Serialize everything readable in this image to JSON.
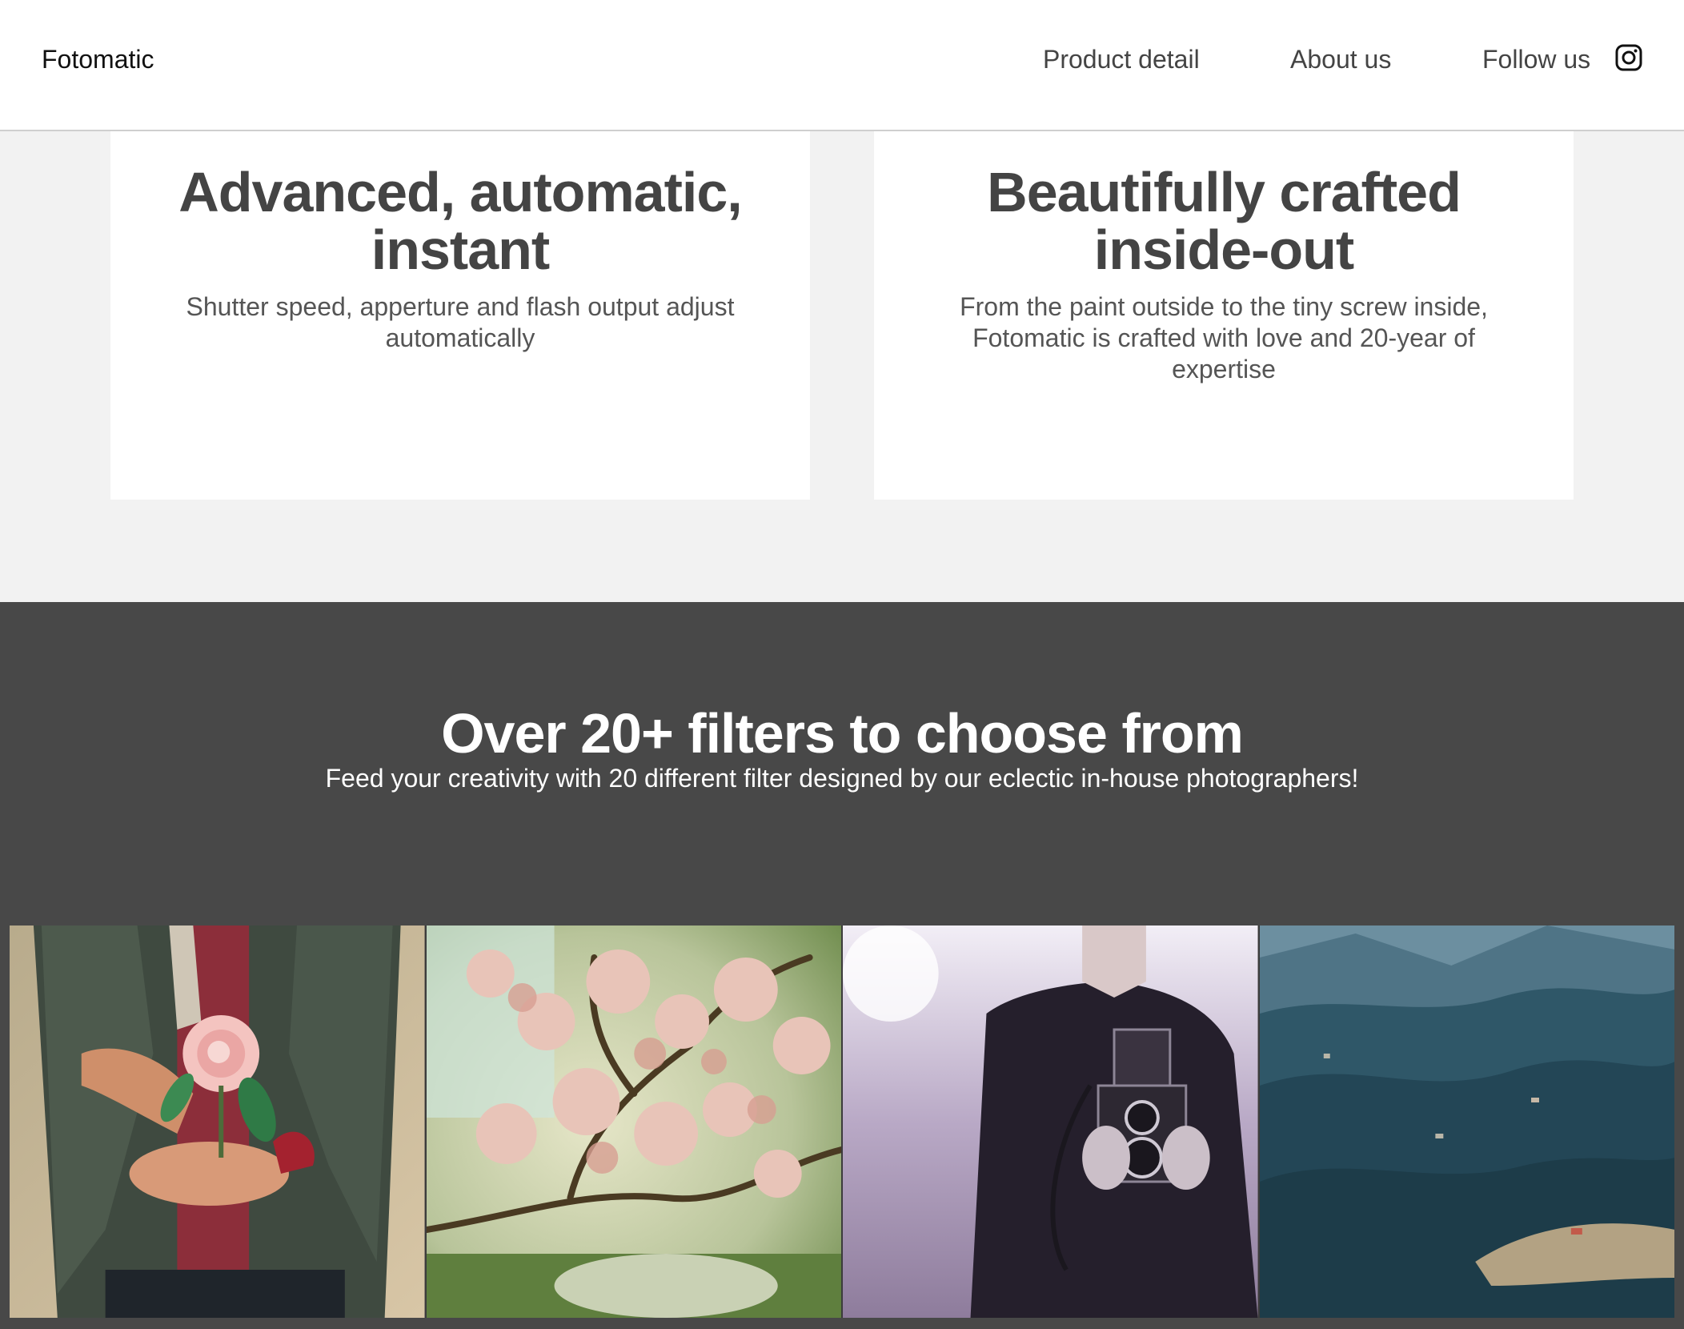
{
  "header": {
    "brand": "Fotomatic",
    "nav": {
      "product": "Product detail",
      "about": "About us",
      "follow": "Follow us"
    },
    "social_icon": "instagram-icon"
  },
  "features": [
    {
      "title": "Advanced, automatic, instant",
      "text": "Shutter speed, apperture and flash output adjust automatically"
    },
    {
      "title": "Beautifully crafted inside-out",
      "text": "From the paint outside to the tiny screw inside, Fotomatic is crafted with love and 20-year of expertise"
    }
  ],
  "filters": {
    "title": "Over 20+ filters to choose from",
    "subtitle": "Feed your creativity with 20 different filter designed by our eclectic in-house photographers!",
    "photos": [
      "photo-person-holding-flower",
      "photo-blossoming-tree",
      "photo-man-with-twin-lens-camera",
      "photo-mountain-valley-landscape"
    ]
  },
  "colors": {
    "header_bg": "#ffffff",
    "features_bg": "#f2f2f2",
    "filters_bg": "#484848",
    "heading_text": "#444444"
  }
}
